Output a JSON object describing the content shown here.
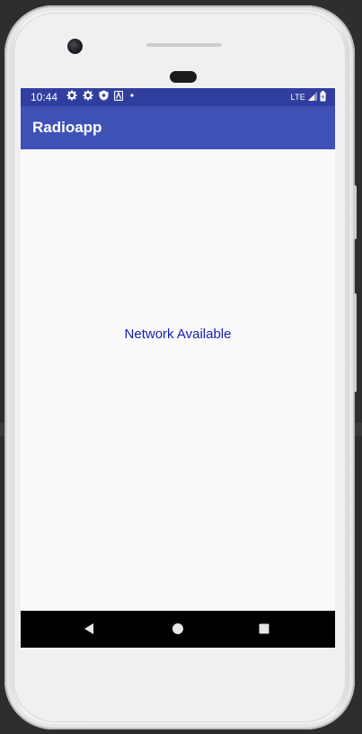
{
  "status_bar": {
    "time": "10:44",
    "network_label": "LTE",
    "icons": [
      "settings-gear-icon",
      "settings-gear-icon",
      "shield-icon",
      "a11y-icon",
      "dot-icon",
      "signal-icon",
      "battery-icon"
    ]
  },
  "app_bar": {
    "title": "Radioapp"
  },
  "content": {
    "message": "Network Available"
  },
  "nav_bar": {
    "buttons": [
      "back",
      "home",
      "recents"
    ]
  },
  "colors": {
    "status_bar": "#303f9f",
    "app_bar": "#3f51b5",
    "message_text": "#1a1ab4",
    "nav_bar": "#000000"
  }
}
